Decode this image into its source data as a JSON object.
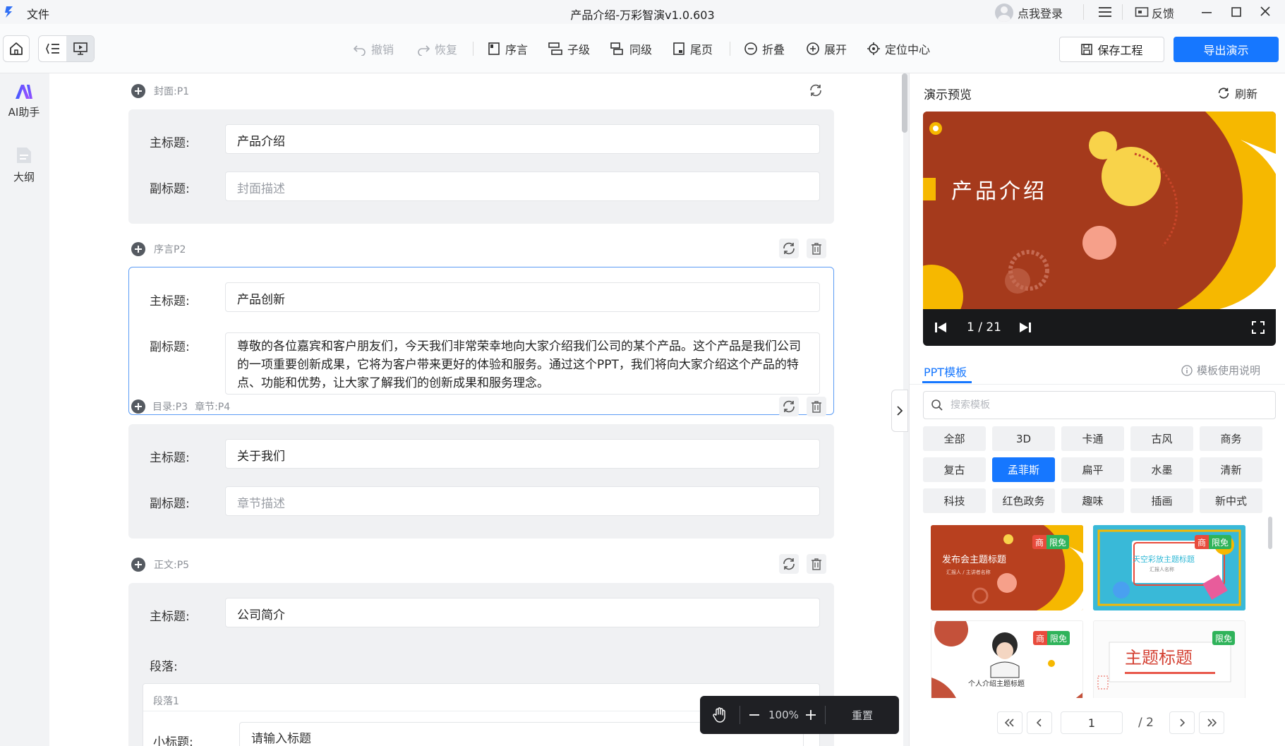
{
  "titlebar": {
    "file_menu": "文件",
    "title": "产品介绍-万彩智演v1.0.603",
    "login": "点我登录",
    "feedback": "反馈"
  },
  "toolbar": {
    "undo": "撤销",
    "redo": "恢复",
    "preface": "序言",
    "child": "子级",
    "sibling": "同级",
    "last_page": "尾页",
    "collapse": "折叠",
    "expand": "展开",
    "locate_center": "定位中心",
    "save_project": "保存工程",
    "export": "导出演示"
  },
  "sidebar": {
    "ai_assistant": "AI助手",
    "outline": "大纲"
  },
  "editor": {
    "labels": {
      "main_title": "主标题:",
      "subtitle": "副标题:",
      "paragraph": "段落:",
      "small_title": "小标题:"
    },
    "sections": [
      {
        "tag": "封面:P1",
        "main_title": "产品介绍",
        "subtitle_placeholder": "封面描述"
      },
      {
        "tag": "序言P2",
        "main_title": "产品创新",
        "subtitle": "尊敬的各位嘉宾和客户朋友们，今天我们非常荣幸地向大家介绍我们公司的某个产品。这个产品是我们公司的一项重要创新成果，它将为客户带来更好的体验和服务。通过这个PPT，我们将向大家介绍这个产品的特点、功能和优势，让大家了解我们的创新成果和服务理念。"
      },
      {
        "tag": "目录:P3",
        "tag2": "章节:P4",
        "main_title": "关于我们",
        "subtitle_placeholder": "章节描述"
      },
      {
        "tag": "正文:P5",
        "main_title": "公司简介",
        "paragraph_title": "段落1",
        "small_title_placeholder": "请输入标题"
      }
    ],
    "zoom": {
      "level": "100%",
      "reset": "重置"
    }
  },
  "preview": {
    "title": "演示预览",
    "refresh": "刷新",
    "slide_title": "产品介绍",
    "page_indicator": "1 / 21",
    "colors": {
      "slide_bg": "#a53a1c",
      "accent_yellow": "#f6b800",
      "accent_pink": "#f6a08a"
    }
  },
  "templates": {
    "tab": "PPT模板",
    "help": "模板使用说明",
    "search_placeholder": "搜索模板",
    "categories": [
      "全部",
      "3D",
      "卡通",
      "古风",
      "商务",
      "复古",
      "孟菲斯",
      "扁平",
      "水墨",
      "清新",
      "科技",
      "红色政务",
      "趣味",
      "插画",
      "新中式"
    ],
    "active_category": "孟菲斯",
    "badge_commercial": "商",
    "badge_free": "限免",
    "items": [
      {
        "title": "发布会主题标题",
        "subtitle": "汇报人 / 主讲者名称"
      },
      {
        "title": "天空彩放主题标题",
        "subtitle": "汇报人名称"
      },
      {
        "title": "个人介绍主题标题",
        "subtitle": ""
      },
      {
        "title": "主题标题",
        "subtitle": ""
      }
    ],
    "pagination": {
      "current": "1",
      "total": "/ 2"
    }
  }
}
